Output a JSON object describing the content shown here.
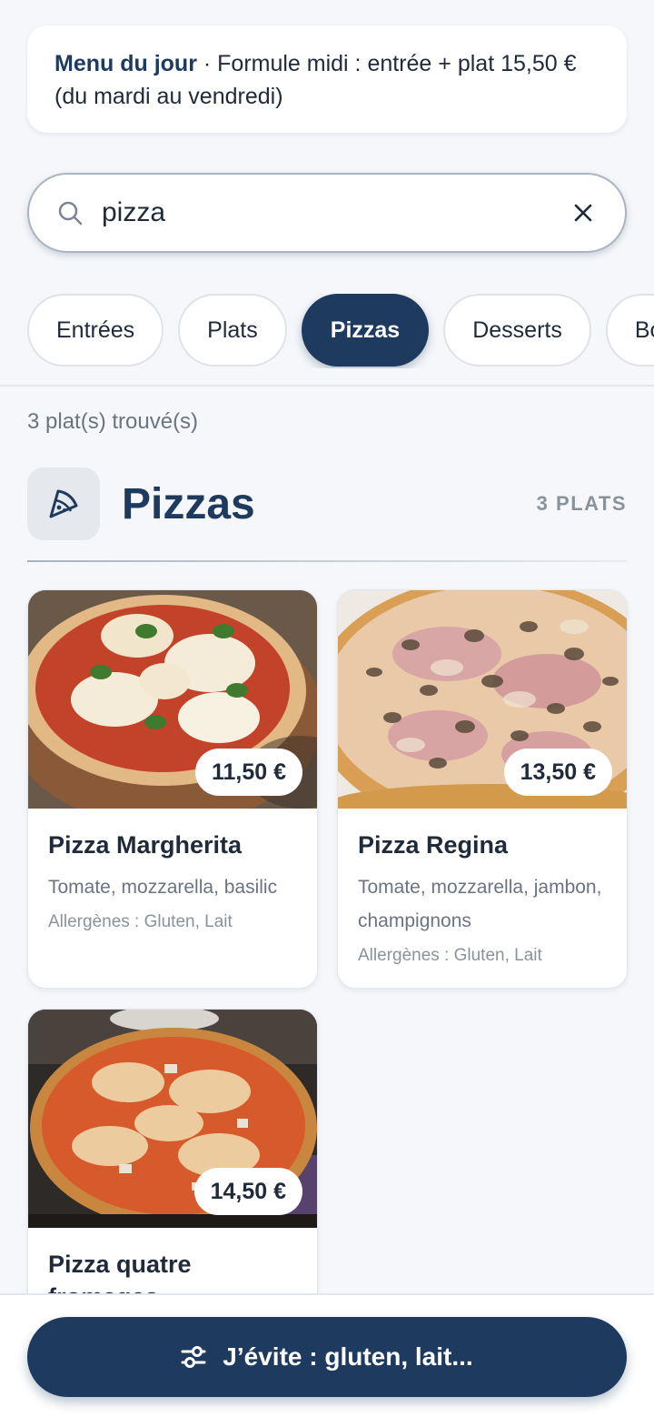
{
  "banner": {
    "title": "Menu du jour",
    "separator": " · ",
    "text": "Formule midi : entrée + plat 15,50 € (du mardi au vendredi)"
  },
  "search": {
    "value": "pizza",
    "icon": "search-icon",
    "clear_icon": "close-icon"
  },
  "categories": [
    {
      "label": "Entrées",
      "active": false
    },
    {
      "label": "Plats",
      "active": false
    },
    {
      "label": "Pizzas",
      "active": true
    },
    {
      "label": "Desserts",
      "active": false
    },
    {
      "label": "Boissons",
      "active": false
    }
  ],
  "results": {
    "count_text": "3 plat(s) trouvé(s)"
  },
  "section": {
    "icon": "pizza-slice-icon",
    "title": "Pizzas",
    "count": "3 PLATS"
  },
  "dishes": [
    {
      "name": "Pizza Margherita",
      "price": "11,50 €",
      "description": "Tomate, mozzarella, basilic",
      "allergens": "Allergènes : Gluten, Lait"
    },
    {
      "name": "Pizza Regina",
      "price": "13,50 €",
      "description": "Tomate, mozzarella, jambon, champignons",
      "allergens": "Allergènes : Gluten, Lait"
    },
    {
      "name": "Pizza quatre fromages",
      "price": "14,50 €",
      "description": "",
      "allergens": ""
    }
  ],
  "filter_button": {
    "label": "J’évite : gluten, lait...",
    "icon": "sliders-icon"
  },
  "colors": {
    "primary": "#1e3a5f",
    "background": "#f5f7fa"
  }
}
